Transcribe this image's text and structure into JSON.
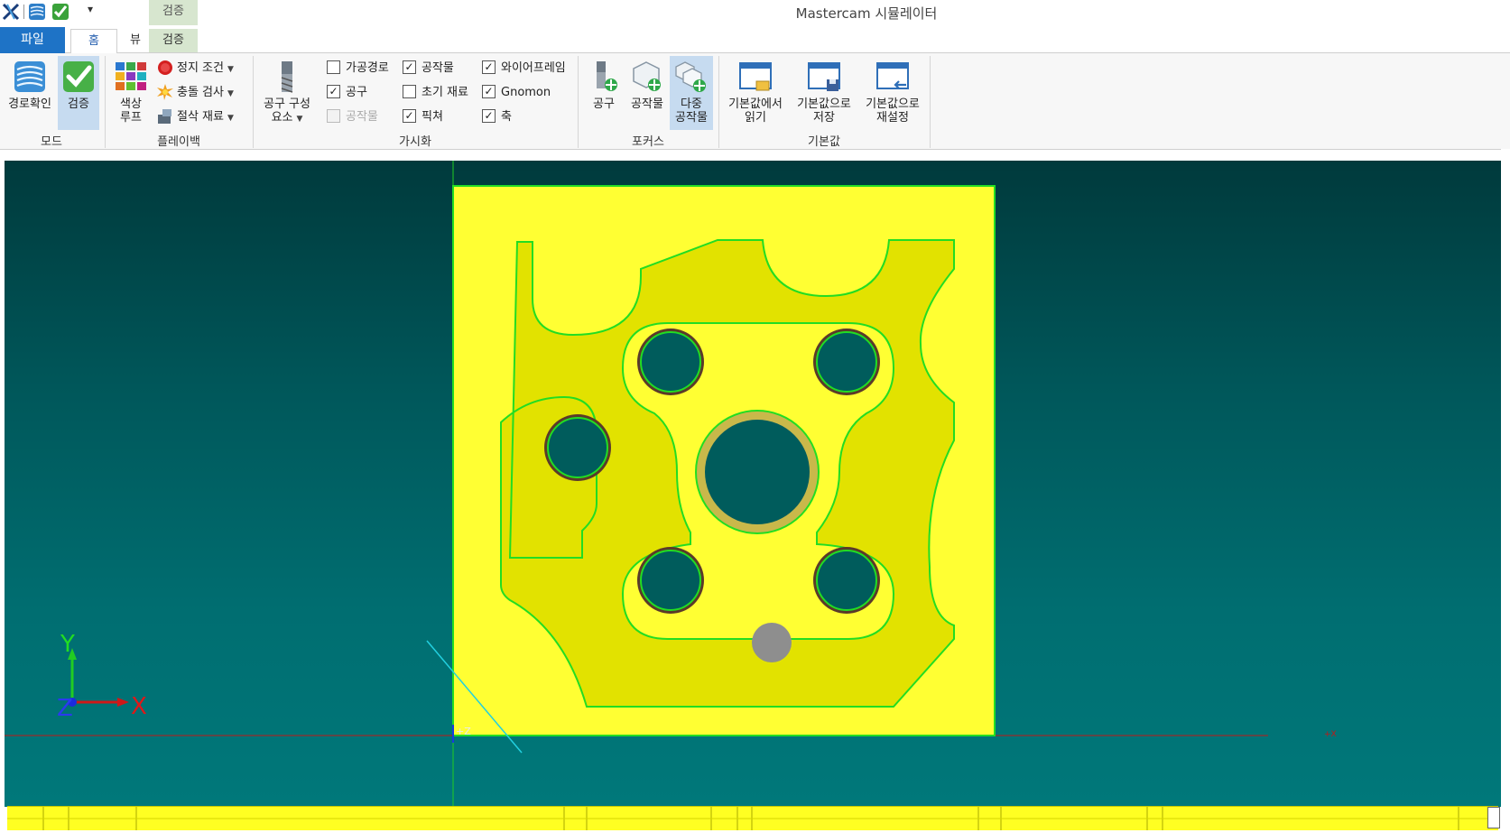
{
  "window": {
    "title": "Mastercam 시뮬레이터"
  },
  "quick_access": {
    "icons": [
      "mastercam-logo-icon",
      "backplot-icon",
      "verify-icon"
    ],
    "more": "▾"
  },
  "tabs": {
    "context_header": "검증",
    "file": "파일",
    "home": "홈",
    "view": "뷰",
    "verify": "검증"
  },
  "ribbon": {
    "mode": {
      "label": "모드",
      "backplot": "경로확인",
      "verify": "검증"
    },
    "playback": {
      "label": "플레이백",
      "color_loop_1": "색상",
      "color_loop_2": "루프",
      "stop_conditions": "정지 조건",
      "collision_check": "충돌 검사",
      "cut_stock": "절삭 재료"
    },
    "tool_components": {
      "line1": "공구 구성",
      "line2": "요소"
    },
    "visibility": {
      "label": "가시화",
      "items": [
        {
          "label": "가공경로",
          "checked": false,
          "disabled": false
        },
        {
          "label": "공구",
          "checked": true,
          "disabled": false
        },
        {
          "label": "공작물",
          "checked": false,
          "disabled": true
        },
        {
          "label": "공작물",
          "checked": true,
          "disabled": false
        },
        {
          "label": "초기 재료",
          "checked": false,
          "disabled": false
        },
        {
          "label": "픽쳐",
          "checked": true,
          "disabled": false
        },
        {
          "label": "와이어프레임",
          "checked": true,
          "disabled": false
        },
        {
          "label": "Gnomon",
          "checked": true,
          "disabled": false
        },
        {
          "label": "축",
          "checked": true,
          "disabled": false
        }
      ]
    },
    "focus": {
      "label": "포커스",
      "tool": "공구",
      "workpiece": "공작물",
      "multi_line1": "다중",
      "multi_line2": "공작물"
    },
    "defaults": {
      "label": "기본값",
      "load_line1": "기본값에서",
      "load_line2": "읽기",
      "save_line1": "기본값으로",
      "save_line2": "저장",
      "reset_line1": "기본값으로",
      "reset_line2": "재설정"
    }
  },
  "viewport": {
    "axis_labels": {
      "x": "X",
      "y": "Y",
      "z": "Z",
      "origin_marker": "+Z"
    },
    "colors": {
      "stock": "#ffff33",
      "stock_edge": "#22dd22",
      "hole": "#005c5c",
      "background_top": "#003a3c",
      "background_bottom": "#00787a"
    }
  },
  "check_mark": "✓"
}
